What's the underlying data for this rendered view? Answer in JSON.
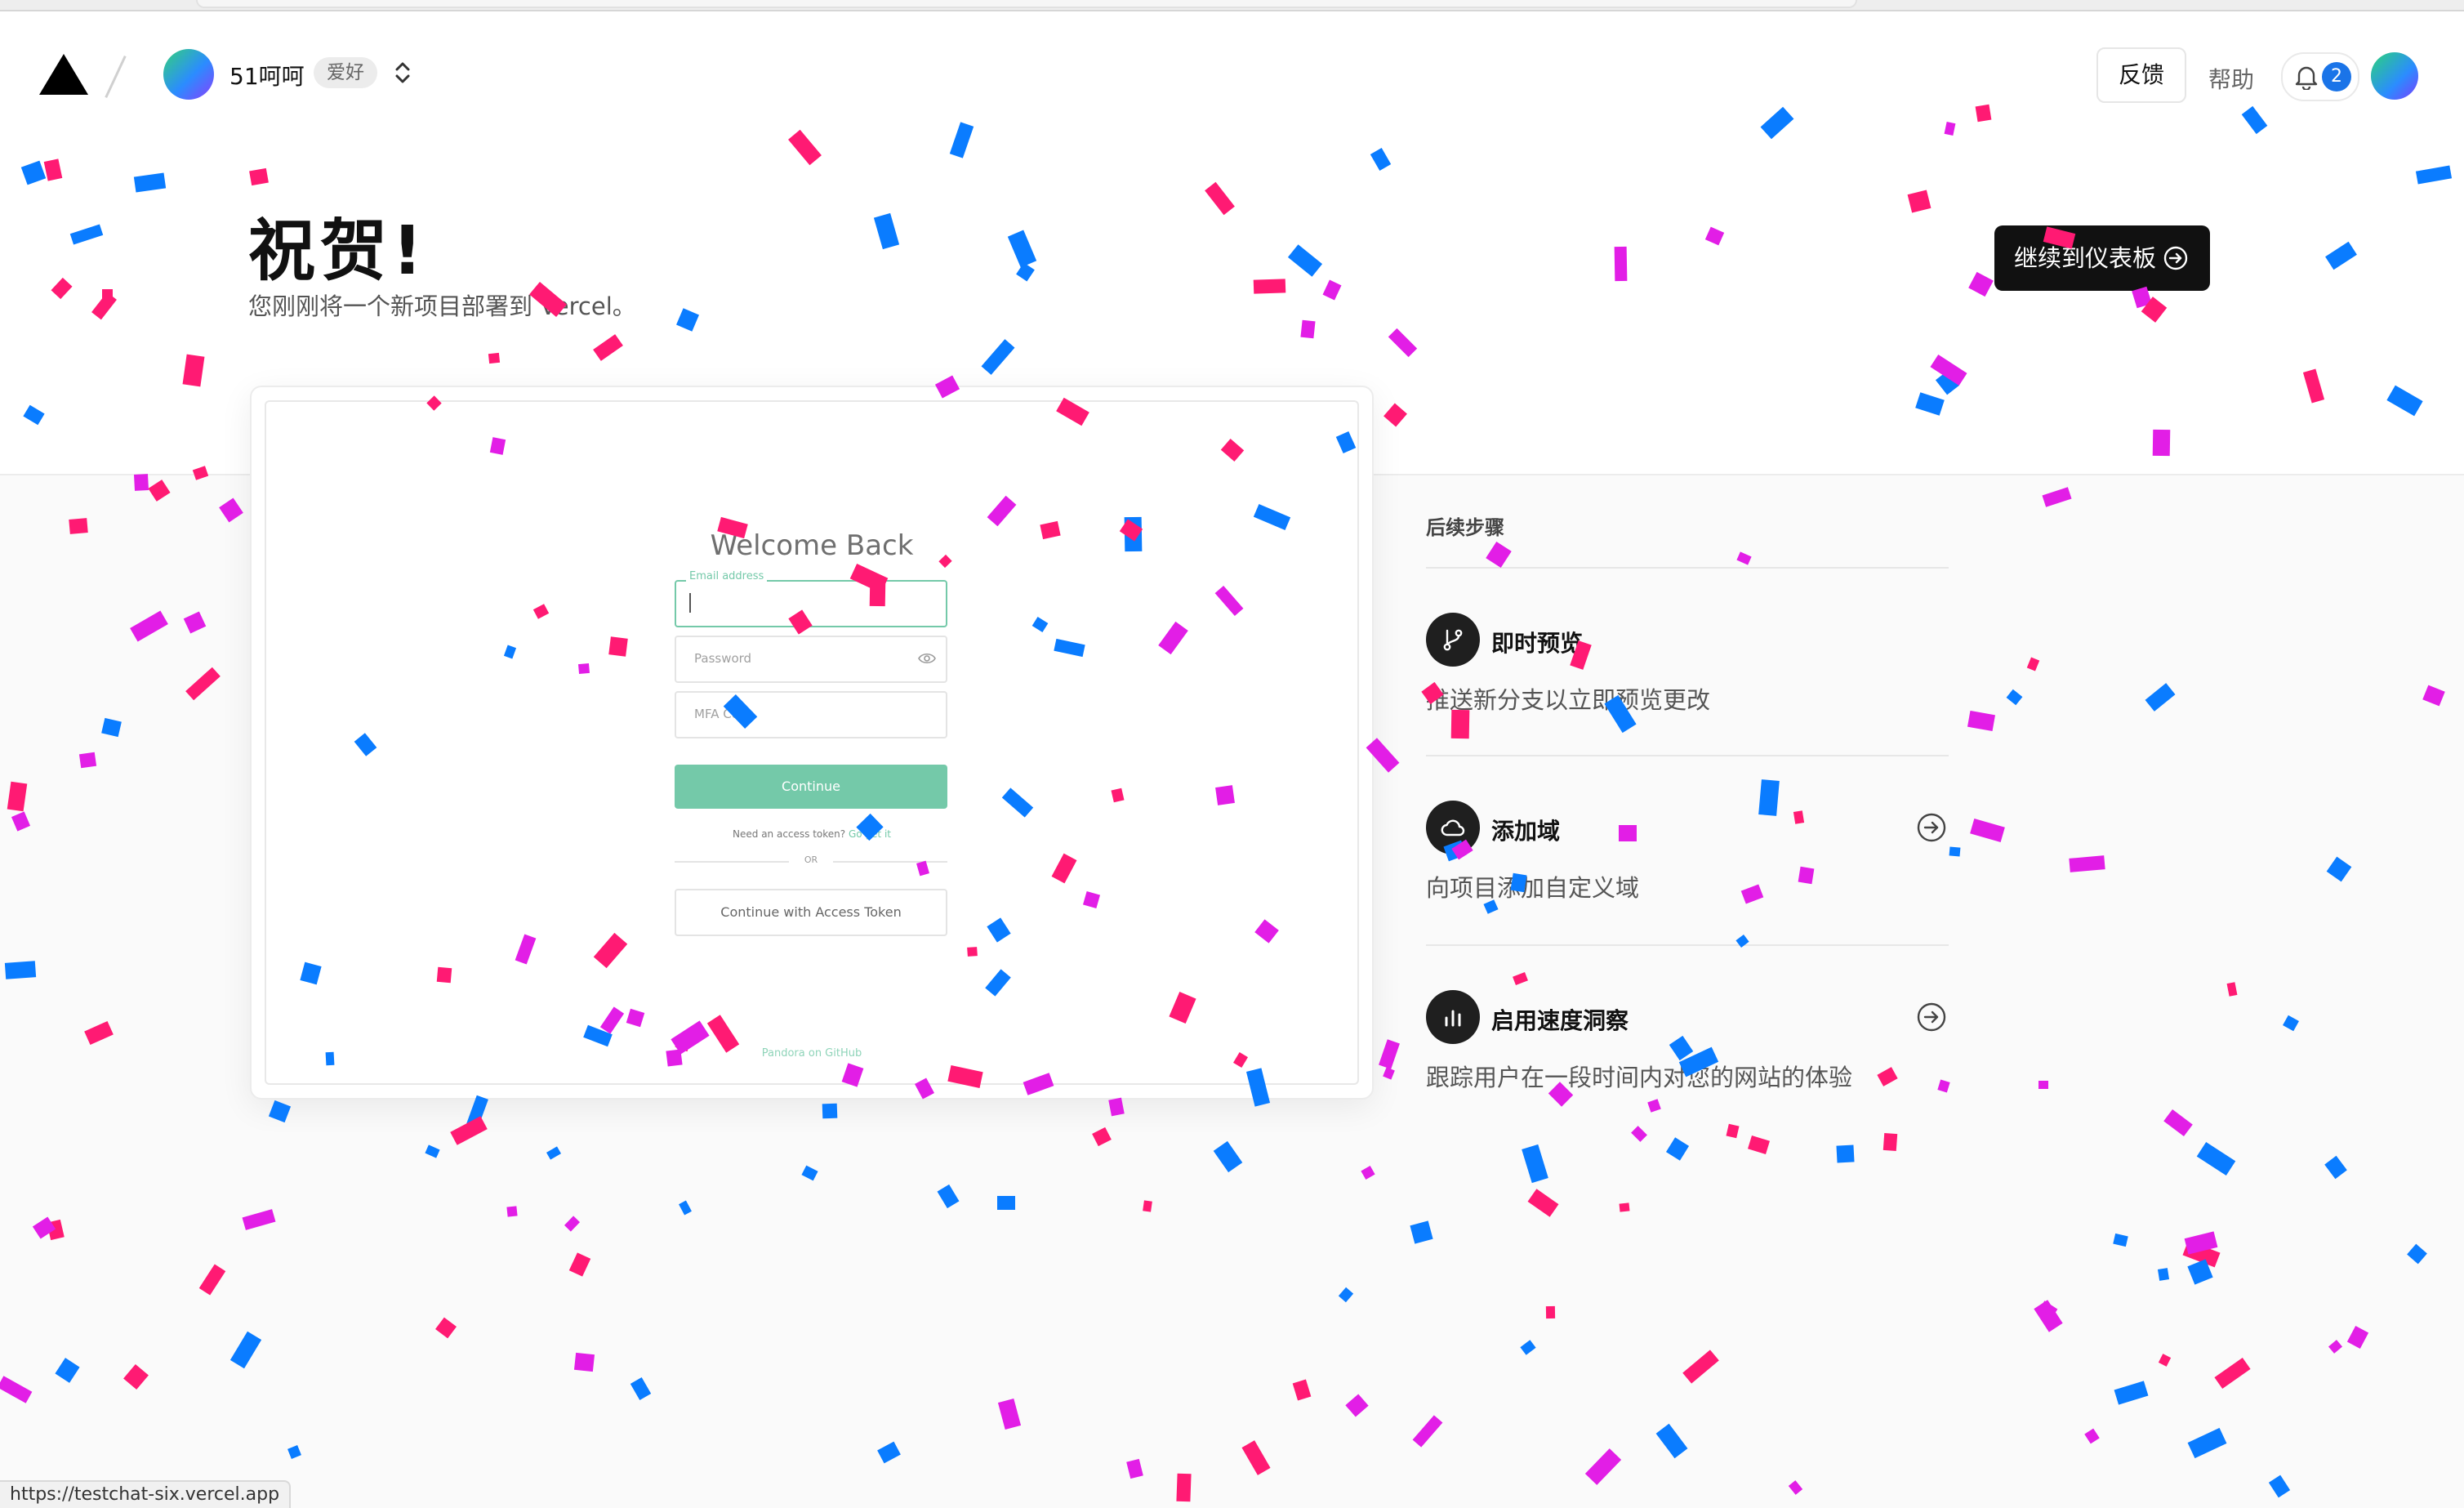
{
  "header": {
    "team_name": "51呵呵",
    "plan_badge": "爱好",
    "feedback_label": "反馈",
    "help_label": "帮助",
    "notification_count": "2"
  },
  "hero": {
    "title": "祝贺!",
    "subtitle": "您刚刚将一个新项目部署到 Vercel。",
    "dashboard_button": "继续到仪表板"
  },
  "preview": {
    "title": "Welcome Back",
    "email_label": "Email address",
    "password_placeholder": "Password",
    "mfa_placeholder": "MFA Code",
    "continue_label": "Continue",
    "need_token_text": "Need an access token?",
    "get_it_link": "Go get it",
    "or_text": "OR",
    "access_token_button": "Continue with Access Token",
    "footer": "Pandora on GitHub"
  },
  "next_steps": {
    "heading": "后续步骤",
    "items": [
      {
        "title": "即时预览",
        "description": "推送新分支以立即预览更改",
        "icon": "git-branch-icon"
      },
      {
        "title": "添加域",
        "description": "向项目添加自定义域",
        "icon": "cloud-icon"
      },
      {
        "title": "启用速度洞察",
        "description": "跟踪用户在一段时间内对您的网站的体验",
        "icon": "bar-chart-icon"
      }
    ]
  },
  "status_bar": {
    "url": "https://testchat-six.vercel.app"
  },
  "colors": {
    "confetti_pink": "#ff1a73",
    "confetti_magenta": "#e21ee6",
    "confetti_blue": "#0a7cff",
    "accent_green": "#74c9a9"
  }
}
